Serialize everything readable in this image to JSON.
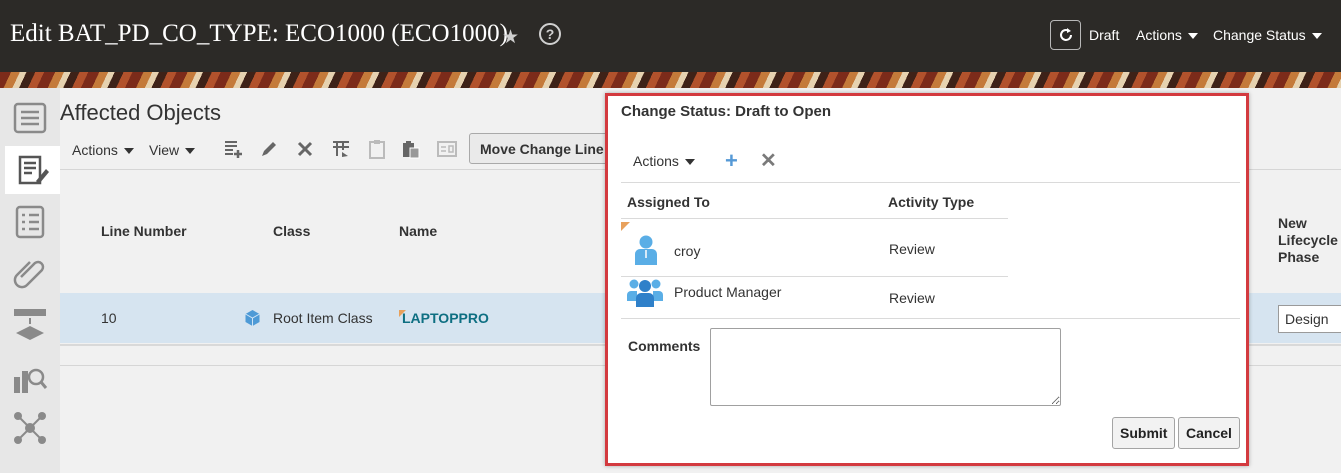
{
  "header": {
    "title": "Edit BAT_PD_CO_TYPE: ECO1000 (ECO1000)",
    "star_glyph": "★",
    "help_glyph": "?",
    "draft_label": "Draft",
    "actions_label": "Actions",
    "change_status_label": "Change Status"
  },
  "icons": {
    "rail": [
      "overview-icon",
      "edit-document-icon",
      "checklist-icon",
      "attachment-icon",
      "structure-icon",
      "search-analysis-icon",
      "network-icon"
    ],
    "toolbar": [
      "add-row-icon",
      "edit-pencil-icon",
      "delete-x-icon",
      "table-grid-icon",
      "clipboard-icon",
      "paste-icon",
      "card-icon"
    ]
  },
  "main": {
    "section_title": "Affected Objects",
    "actions_label": "Actions",
    "view_label": "View",
    "move_change_button": "Move Change Line",
    "columns": {
      "line_number": "Line Number",
      "class": "Class",
      "name": "Name",
      "new_lifecycle_phase": "New Lifecycle Phase"
    },
    "rows": [
      {
        "line_number": "10",
        "class": "Root Item Class",
        "name": "LAPTOPPRO",
        "new_lifecycle_phase": "Design"
      }
    ]
  },
  "dialog": {
    "title": "Change Status: Draft to Open",
    "actions_label": "Actions",
    "plus_glyph": "+",
    "x_glyph": "✕",
    "columns": {
      "assigned_to": "Assigned To",
      "activity_type": "Activity Type"
    },
    "rows": [
      {
        "assigned_to": "croy",
        "activity_type": "Review"
      },
      {
        "assigned_to": "Product Manager",
        "activity_type": "Review"
      }
    ],
    "comments_label": "Comments",
    "comments_value": "",
    "submit_label": "Submit",
    "cancel_label": "Cancel"
  },
  "colors": {
    "header_bg": "#2c2a27",
    "dialog_border": "#d33a3f",
    "selected_row": "#d6e4f0",
    "accent_blue": "#5599d6",
    "link_teal": "#0e6f82"
  }
}
